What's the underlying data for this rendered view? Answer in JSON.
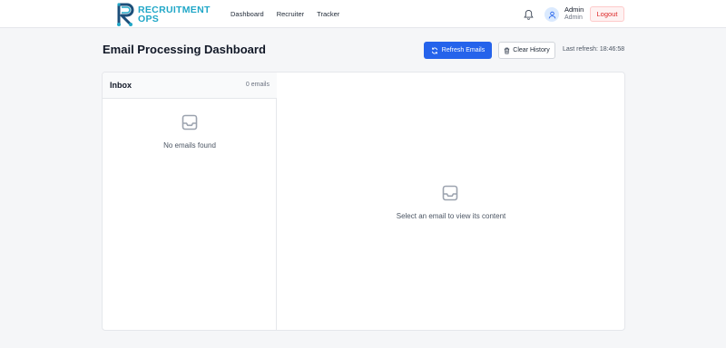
{
  "brand": {
    "line1": "RECRUITMENT",
    "line2": "OPS",
    "color": "#20a7c7"
  },
  "nav": {
    "items": [
      "Dashboard",
      "Recruiter",
      "Tracker"
    ]
  },
  "user": {
    "name": "Admin",
    "role": "Admin",
    "logout_label": "Logout"
  },
  "icons": {
    "notifications": "bell-icon",
    "avatar": "user-icon",
    "refresh": "refresh-icon",
    "clear": "trash-icon",
    "empty": "inbox-tray-icon"
  },
  "page": {
    "title": "Email Processing Dashboard"
  },
  "toolbar": {
    "refresh_label": "Refresh Emails",
    "clear_label": "Clear History",
    "last_refresh": "Last refresh: 18:46:58"
  },
  "inbox": {
    "title": "Inbox",
    "count": "0 emails",
    "empty_text": "No emails found"
  },
  "viewer": {
    "empty_text": "Select an email to view its content"
  },
  "colors": {
    "primary": "#2563eb",
    "danger": "#dc2626",
    "background": "#f5f6f8"
  }
}
